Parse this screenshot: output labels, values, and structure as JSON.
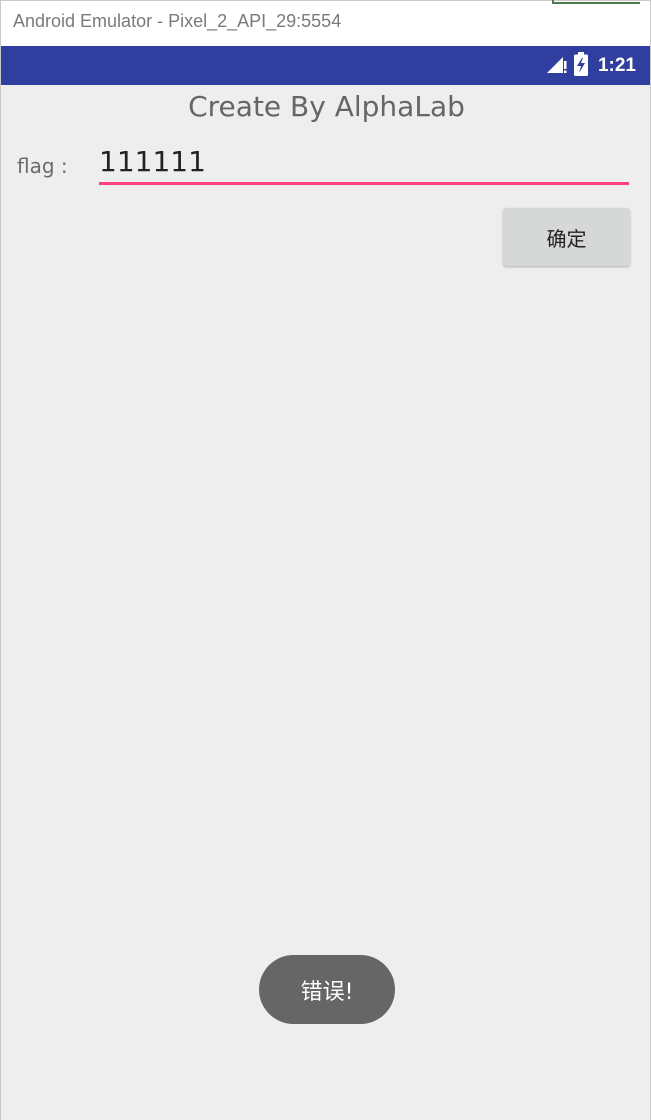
{
  "window": {
    "title": "Android Emulator - Pixel_2_API_29:5554"
  },
  "status_bar": {
    "time": "1:21",
    "background_color": "#303f9f",
    "icons": [
      "signal-icon",
      "battery-icon"
    ]
  },
  "app": {
    "title": "Create By AlphaLab",
    "flag_label": "flag :",
    "flag_value": "111111",
    "confirm_label": "确定",
    "accent_color": "#ff4081"
  },
  "toast": {
    "message": "错误!"
  }
}
